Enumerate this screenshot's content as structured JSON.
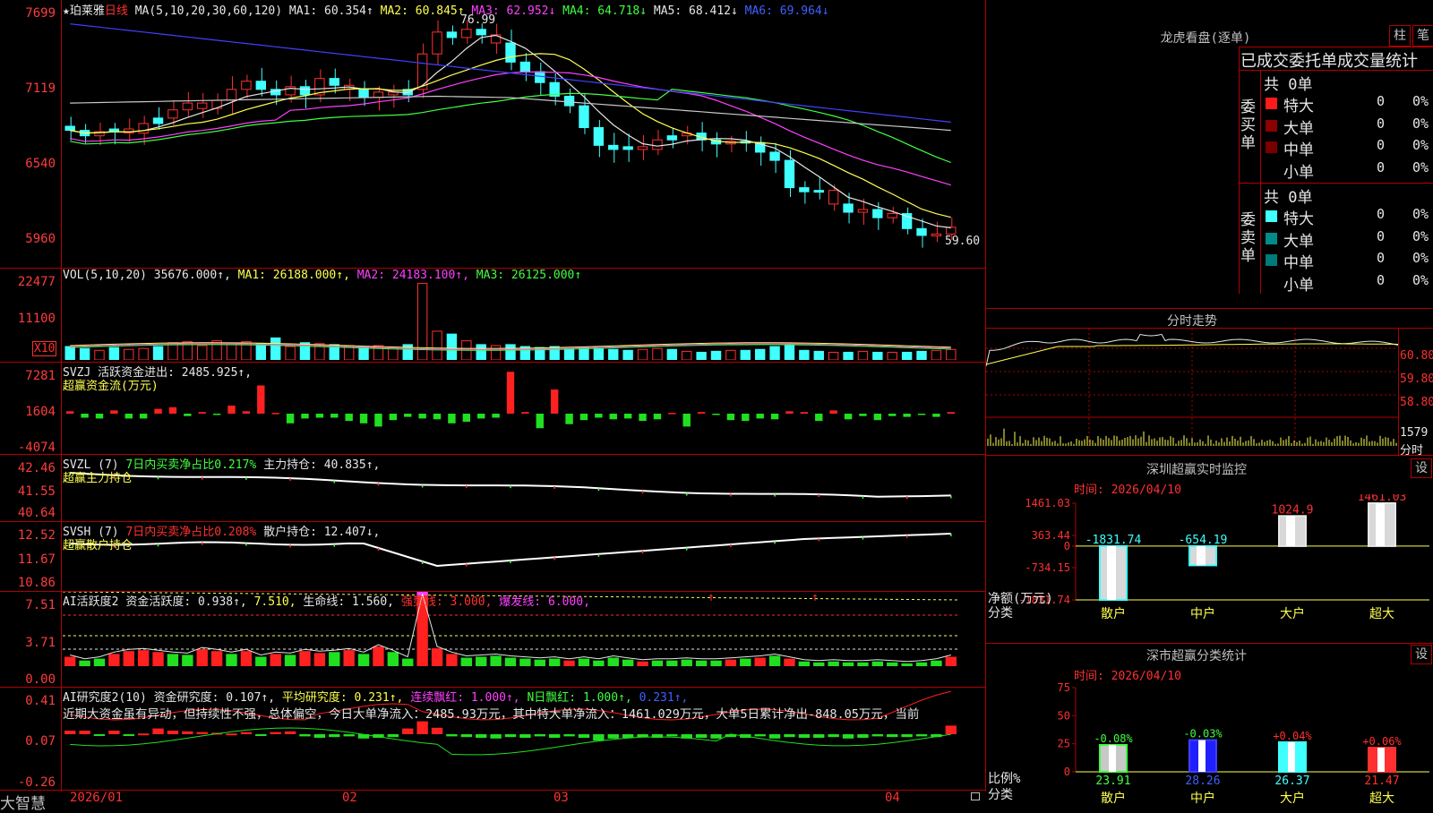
{
  "stock": {
    "star": "★",
    "name": "珀莱雅",
    "period": "日线",
    "max_label": "76.99",
    "min_label": "59.60"
  },
  "main_header": {
    "ma_def": "MA(5,10,20,30,60,120)",
    "ma1": "MA1: 60.354↑",
    "ma2": "MA2: 60.845↑",
    "ma3": "MA3: 62.952↓",
    "ma4": "MA4: 64.718↓",
    "ma5": "MA5: 68.412↓",
    "ma6": "MA6: 69.964↓"
  },
  "main_axis": [
    "7699",
    "7119",
    "6540",
    "5960"
  ],
  "vol_header": {
    "def": "VOL(5,10,20)",
    "vol": "35676.000↑,",
    "ma1": "MA1: 26188.000↑,",
    "ma2": "MA2: 24183.100↑,",
    "ma3": "MA3: 26125.000↑"
  },
  "vol_axis": [
    "22477",
    "11100",
    "X10"
  ],
  "svzj_header": {
    "name": "SVZJ",
    "label": "活跃资金进出: 2485.925↑,",
    "sub": "超赢资金流(万元)"
  },
  "svzj_axis": [
    "7281",
    "1604",
    "-4074"
  ],
  "svzl_header": {
    "name": "SVZL (7)",
    "desc": "7日内买卖净占比0.217%",
    "val": "主力持仓: 40.835↑,",
    "sub": "超赢主力持仓"
  },
  "svzl_axis": [
    "42.46",
    "41.55",
    "40.64"
  ],
  "svsh_header": {
    "name": "SVSH (7)",
    "desc": "7日内买卖净占比0.208%",
    "val": "散户持仓: 12.407↓,",
    "sub": "超赢散户持仓"
  },
  "svsh_axis": [
    "12.52",
    "11.67",
    "10.86"
  ],
  "ai1_header": {
    "name": "AI活跃度2",
    "v1": "资金活跃度: 0.938↑,",
    "v2": "7.510,",
    "v3": "生命线: 1.560,",
    "v4": "强势线: 3.000,",
    "v5": "爆发线: 6.000,"
  },
  "ai1_axis": [
    "7.51",
    "3.71",
    "0.00"
  ],
  "ai2_header": {
    "name": "AI研究度2(10)",
    "v1": "资金研究度: 0.107↑,",
    "v2": "平均研究度: 0.231↑,",
    "v3": "连续飘红: 1.000↑,",
    "v4": "N日飘红: 1.000↑,",
    "v5": "0.231↑,"
  },
  "ai2_text": "近期大资金虽有异动，但持续性不强，总体偏空，今日大单净流入：2485.93万元，其中特大单净流入：1461.029万元，大单5日累计净出-848.05万元，当前",
  "ai2_axis": [
    "0.41",
    "0.07",
    "-0.26"
  ],
  "date_axis": [
    "2026/01",
    "02",
    "03",
    "04"
  ],
  "brand": "大智慧",
  "lhb": {
    "title": "龙虎看盘(逐单)",
    "btn1": "柱",
    "btn2": "笔",
    "sub": "已成交委托单成交量统计",
    "buy_label": "委买单",
    "sell_label": "委卖单",
    "buy_total": "共 0单",
    "sell_total": "共 0单",
    "buy_rows": [
      {
        "name": "特大",
        "v": "0",
        "p": "0%",
        "color": "#ff1a1a"
      },
      {
        "name": "大单",
        "v": "0",
        "p": "0%",
        "color": "#8b0000"
      },
      {
        "name": "中单",
        "v": "0",
        "p": "0%",
        "color": "#7a0000"
      },
      {
        "name": "小单",
        "v": "0",
        "p": "0%",
        "color": ""
      }
    ],
    "sell_rows": [
      {
        "name": "特大",
        "v": "0",
        "p": "0%",
        "color": "#40ffff"
      },
      {
        "name": "大单",
        "v": "0",
        "p": "0%",
        "color": "#008b8b"
      },
      {
        "name": "中单",
        "v": "0",
        "p": "0%",
        "color": "#007a7a"
      },
      {
        "name": "小单",
        "v": "0",
        "p": "0%",
        "color": ""
      }
    ]
  },
  "fenshi": {
    "title": "分时走势",
    "axis": [
      "60.80",
      "59.80",
      "58.80",
      "1579"
    ],
    "vol_unit": "分时"
  },
  "monitor": {
    "title": "深圳超赢实时监控",
    "btn": "设",
    "time": "时间: 2026/04/10",
    "axis": [
      "1461.03",
      "363.44",
      "0",
      "-734.15",
      "-1831.74"
    ],
    "ylabel": "净额(万元)",
    "xlabel": "分类",
    "categories": [
      "散户",
      "中户",
      "大户",
      "超大"
    ],
    "values": [
      -1831.74,
      -654.19,
      1024.9,
      1461.03
    ],
    "value_labels": [
      "-1831.74",
      "-654.19",
      "1024.9",
      "1461.03"
    ]
  },
  "classify": {
    "title": "深市超赢分类统计",
    "btn": "设",
    "time": "时间: 2026/04/10",
    "axis": [
      "75",
      "50",
      "25",
      "0"
    ],
    "ylabel": "比例%",
    "xlabel": "分类",
    "categories": [
      "散户",
      "中户",
      "大户",
      "超大"
    ],
    "values": [
      23.91,
      28.26,
      26.37,
      21.47
    ],
    "changes": [
      "-0.08%",
      "-0.03%",
      "+0.04%",
      "+0.06%"
    ]
  },
  "chart_data": [
    {
      "type": "bar",
      "title": "深圳超赢实时监控",
      "categories": [
        "散户",
        "中户",
        "大户",
        "超大"
      ],
      "values": [
        -1831.74,
        -654.19,
        1024.9,
        1461.03
      ],
      "ylabel": "净额(万元)",
      "xlabel": "分类",
      "ylim": [
        -1831.74,
        1461.03
      ]
    },
    {
      "type": "bar",
      "title": "深市超赢分类统计",
      "categories": [
        "散户",
        "中户",
        "大户",
        "超大"
      ],
      "values": [
        23.91,
        28.26,
        26.37,
        21.47
      ],
      "ylabel": "比例%",
      "xlabel": "分类",
      "ylim": [
        0,
        75
      ]
    }
  ]
}
